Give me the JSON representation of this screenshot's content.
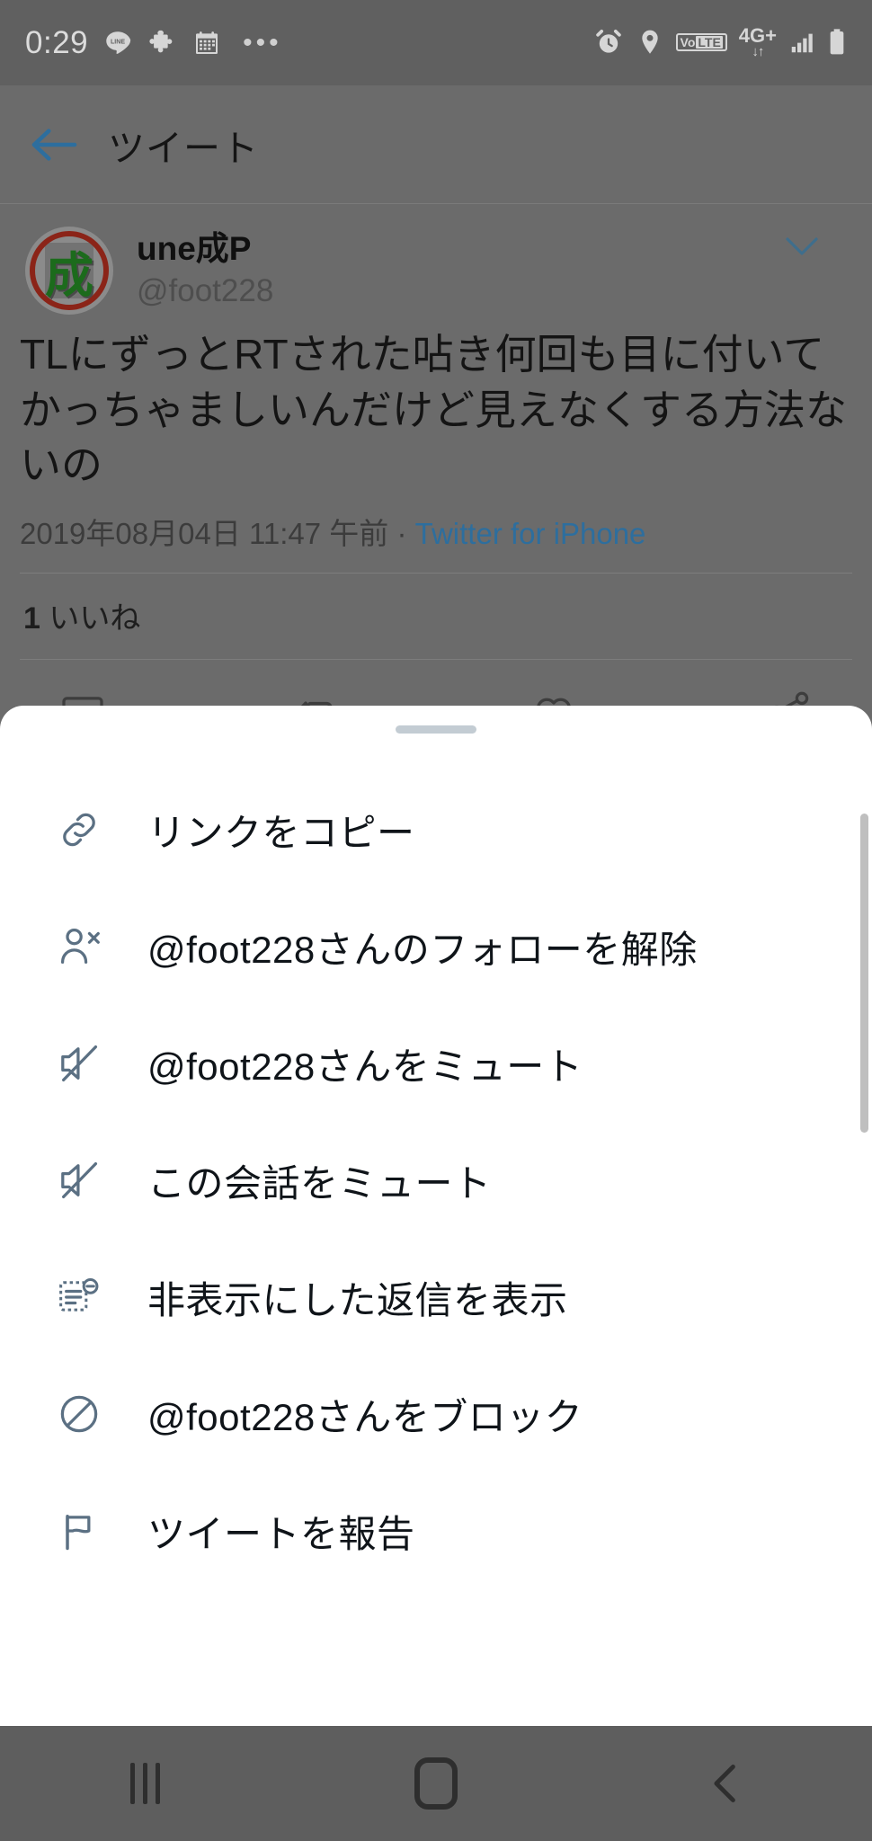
{
  "status_bar": {
    "clock": "0:29",
    "left_icons": [
      "line-icon",
      "puzzle-icon",
      "calendar-icon",
      "more-dots-icon"
    ],
    "more_dots": "•••",
    "right_icons": [
      "alarm-icon",
      "location-icon",
      "volte-icon",
      "network-4g-icon",
      "signal-icon",
      "battery-icon"
    ],
    "volte_vo": "Vo",
    "volte_lte": "LTE",
    "network_label": "4G+",
    "network_arrows": "↓↑"
  },
  "app_bar": {
    "back_icon": "back-arrow-icon",
    "title": "ツイート"
  },
  "tweet": {
    "avatar_glyph": "成",
    "display_name": "une成P",
    "handle": "@foot228",
    "caret_icon": "chevron-down-icon",
    "body": "TLにずっとRTされた呫き何回も目に付いてかっちゃましいんだけど見えなくする方法ないの",
    "timestamp": "2019年08月04日 11:47 午前 · ",
    "source": "Twitter for iPhone",
    "likes_count": "1",
    "likes_label": "いいね",
    "actions": [
      "reply-icon",
      "retweet-icon",
      "like-icon",
      "share-icon"
    ]
  },
  "sheet": {
    "grabber": "sheet-grabber",
    "items": [
      {
        "icon": "link-icon",
        "label": "リンクをコピー"
      },
      {
        "icon": "user-unfollow-icon",
        "label": "@foot228さんのフォローを解除"
      },
      {
        "icon": "mute-icon",
        "label": "@foot228さんをミュート"
      },
      {
        "icon": "mute-icon",
        "label": "この会話をミュート"
      },
      {
        "icon": "hidden-replies-icon",
        "label": "非表示にした返信を表示"
      },
      {
        "icon": "block-icon",
        "label": "@foot228さんをブロック"
      },
      {
        "icon": "report-flag-icon",
        "label": "ツイートを報告"
      }
    ]
  },
  "nav_bar": {
    "recents_icon": "recents-icon",
    "home_icon": "home-icon",
    "back_icon": "nav-back-icon"
  },
  "colors": {
    "accent_blue": "#2d6e9e",
    "sheet_bg": "#ffffff",
    "scrim": "#6b6b6b",
    "icon_gray": "#5b7083"
  }
}
